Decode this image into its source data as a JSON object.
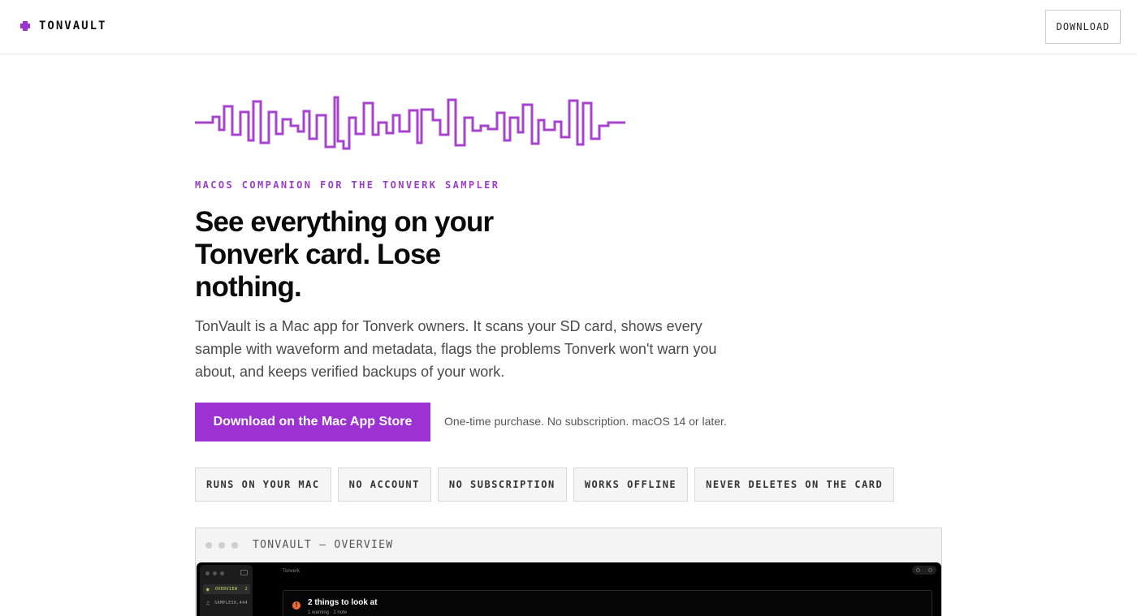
{
  "header": {
    "brand_name": "TONVAULT",
    "download_label": "DOWNLOAD"
  },
  "brand": {
    "accent": "#9b32d1",
    "logo_icon": "puzzle-icon"
  },
  "hero": {
    "eyebrow": "MACOS COMPANION FOR THE TONVERK SAMPLER",
    "headline": "See everything on your Tonverk card. Lose nothing.",
    "description": "TonVault is a Mac app for Tonverk owners. It scans your SD card, shows every sample with waveform and metadata, flags the problems Tonverk won't warn you about, and keeps verified backups of your work.",
    "cta_label": "Download on the Mac App Store",
    "cta_note": "One-time purchase. No subscription. macOS 14 or later."
  },
  "features": [
    "RUNS ON YOUR MAC",
    "NO ACCOUNT",
    "NO SUBSCRIPTION",
    "WORKS OFFLINE",
    "NEVER DELETES ON THE CARD"
  ],
  "preview": {
    "window_title": "TONVAULT — OVERVIEW",
    "app_title": "Tonverk",
    "sidebar": [
      {
        "icon": "eye-icon",
        "label": "OVERVIEW",
        "count": "2",
        "active": true
      },
      {
        "icon": "music-note-icon",
        "label": "SAMPLES",
        "count": "6,444",
        "active": false
      }
    ],
    "alert": {
      "icon": "info-icon",
      "title": "2 things to look at",
      "subtitle": "1 warning · 1 note"
    }
  }
}
